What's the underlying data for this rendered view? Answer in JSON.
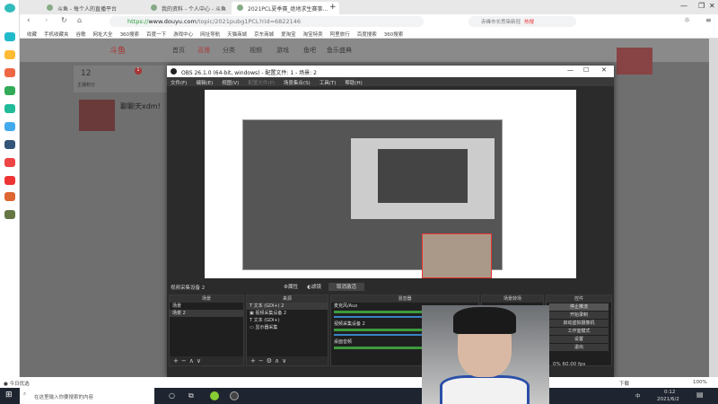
{
  "browser": {
    "tabs": [
      {
        "label": "斗鱼 - 每个人的直播平台"
      },
      {
        "label": "我的资料 - 个人中心 - 斗鱼"
      },
      {
        "label": "2021PCL夏季赛_绝地求生赛事..."
      }
    ],
    "new_tab": "+",
    "url_scheme": "https://",
    "url_host": "www.douyu.com",
    "url_path": "/topic/2021pubg1PCL?rid=6822146",
    "search_placeholder": "赤峰市长思染新冠",
    "search_hot": "热搜",
    "bookmarks": [
      "收藏",
      "手机收藏夹",
      "谷歌",
      "网址大全",
      "360搜索",
      "百度一下",
      "游戏中心",
      "网址导航",
      "天猫商城",
      "京东商城",
      "爱淘宝",
      "淘宝特卖",
      "阿里旅行",
      "百度搜索",
      "360搜索"
    ]
  },
  "site": {
    "logo": "斗鱼",
    "nav": [
      "首页",
      "直播",
      "分类",
      "视频",
      "游戏",
      "鱼吧",
      "鱼乐盛典"
    ],
    "stat_value": "12",
    "stat_label": "主播积分",
    "badge": "1",
    "streamer": "聊聊天xdm!"
  },
  "obs": {
    "title": "OBS 26.1.0 (64-bit, windows) - 配置文件: 1 - 场景: 2",
    "menu": [
      "文件(F)",
      "编辑(E)",
      "视图(V)",
      "配置文件(P)",
      "场景集合(S)",
      "工具(T)",
      "帮助(H)"
    ],
    "source_selected": "视频采集设备 2",
    "properties": "属性",
    "filters": "滤镜",
    "deactivate": "取消激活",
    "scenes_title": "场景",
    "scenes": [
      "场景",
      "场景 2"
    ],
    "sources_title": "来源",
    "sources": [
      "文本 (GDI+) 2",
      "视频采集设备 2",
      "文本 (GDI+)",
      "显示器采集"
    ],
    "mixer_title": "混音器",
    "mixer": [
      "麦克风/Aux",
      "视频采集设备 2",
      "桌面音频"
    ],
    "transitions_title": "场景转场",
    "controls_title": "控件",
    "controls": [
      "停止推流",
      "开始录制",
      "启动虚拟摄像机",
      "工作室模式",
      "设置",
      "退出"
    ],
    "status": "0% 60.00 fps"
  },
  "statusbar": {
    "left": "今日优选",
    "zoom": "100%",
    "download": "下载"
  },
  "taskbar": {
    "search_placeholder": "在这里输入你要搜索的内容",
    "time": "0:12",
    "date": "2021/6/2",
    "ime": "中"
  }
}
